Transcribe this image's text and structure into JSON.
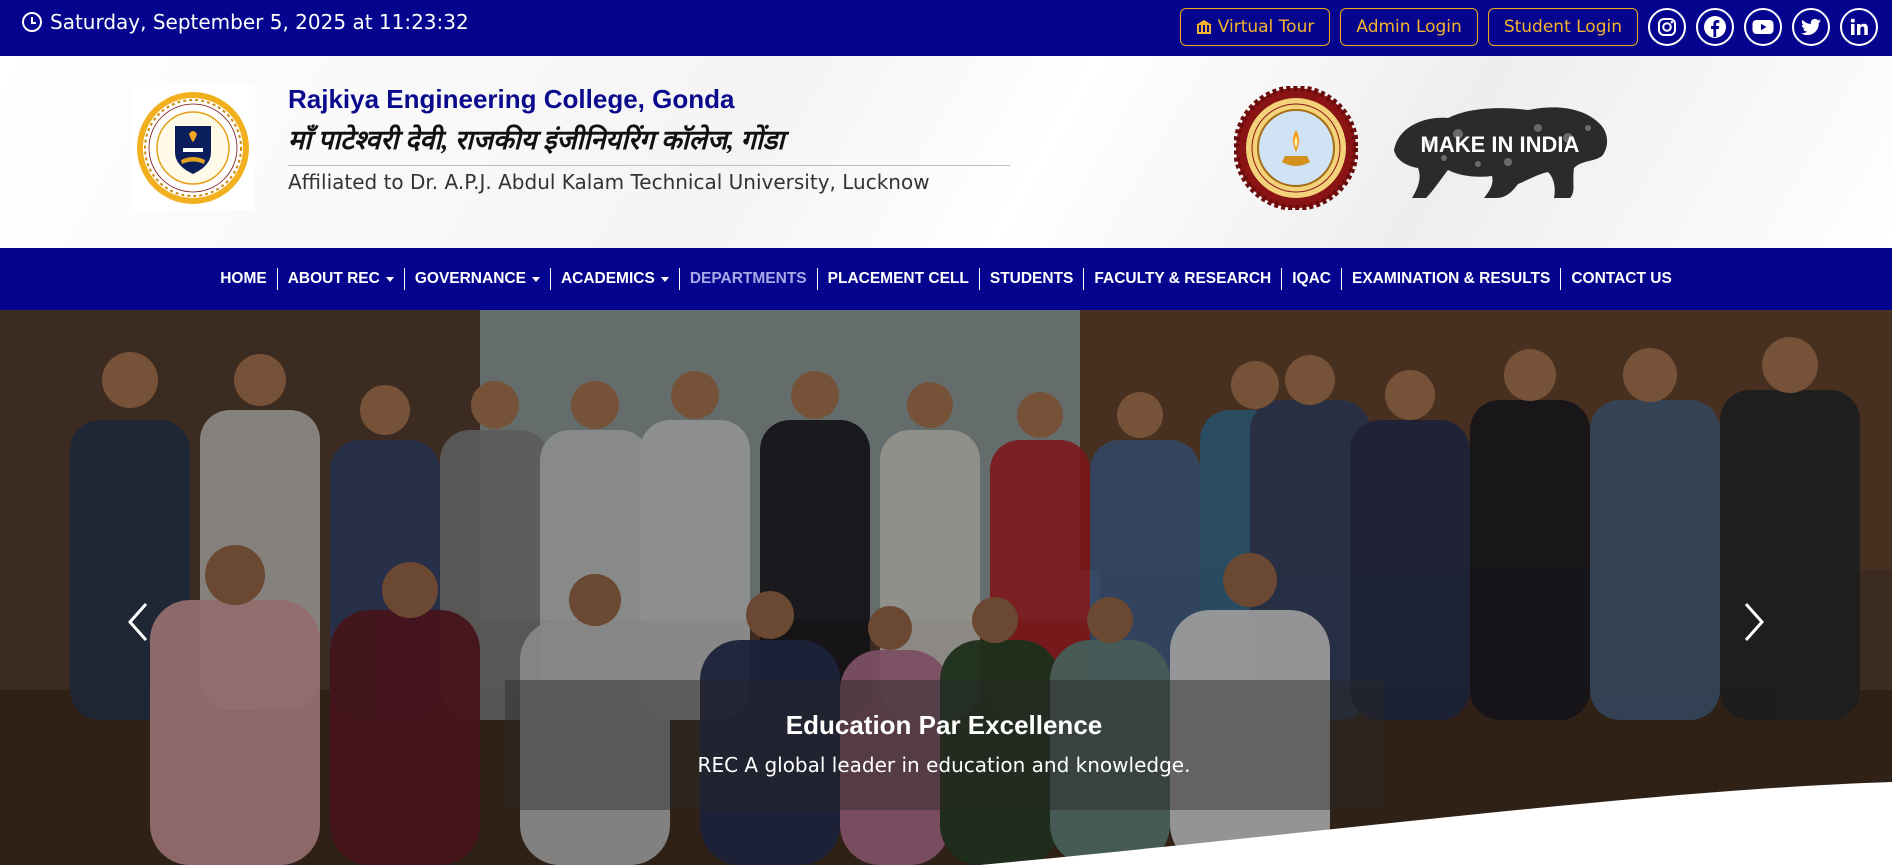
{
  "topbar": {
    "datetime": "Saturday, September 5, 2025 at 11:23:32",
    "virtual_tour": "Virtual Tour",
    "admin_login": "Admin Login",
    "student_login": "Student Login",
    "social_icons": [
      "instagram-icon",
      "facebook-icon",
      "youtube-icon",
      "twitter-icon",
      "linkedin-icon"
    ]
  },
  "header": {
    "college_name_en": "Rajkiya Engineering College, Gonda",
    "college_name_hi": "माँ पाटेश्वरी देवी, राजकीय इंजीनियरिंग कॉलेज, गोंडा",
    "affiliation": "Affiliated to Dr. A.P.J. Abdul Kalam Technical University, Lucknow",
    "make_in_india": "MAKE IN INDIA"
  },
  "nav": {
    "items": [
      {
        "label": "HOME"
      },
      {
        "label": "ABOUT REC"
      },
      {
        "label": "GOVERNANCE"
      },
      {
        "label": "ACADEMICS"
      },
      {
        "label": "DEPARTMENTS"
      },
      {
        "label": "PLACEMENT CELL"
      },
      {
        "label": "STUDENTS"
      },
      {
        "label": "FACULTY & RESEARCH"
      },
      {
        "label": "IQAC"
      },
      {
        "label": "EXAMINATION & RESULTS"
      },
      {
        "label": "CONTACT US"
      }
    ]
  },
  "hero": {
    "title": "Education Par Excellence",
    "subtitle": "REC A global leader in education and knowledge."
  },
  "colors": {
    "primary": "#04048f",
    "accent": "#f5b32b",
    "nav_active": "#a9a9e8"
  }
}
